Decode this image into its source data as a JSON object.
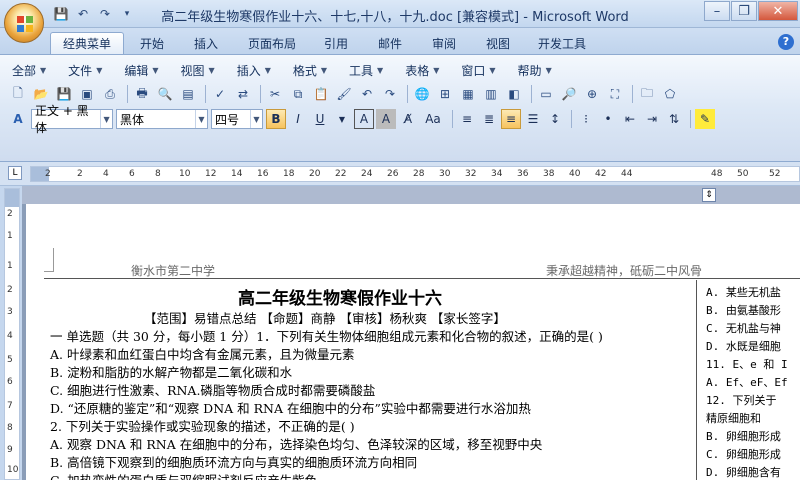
{
  "window": {
    "title": "高二年级生物寒假作业十六、十七,十八，十九.doc [兼容模式] - Microsoft Word"
  },
  "tabs": [
    "经典菜单",
    "开始",
    "插入",
    "页面布局",
    "引用",
    "邮件",
    "审阅",
    "视图",
    "开发工具"
  ],
  "active_tab": "经典菜单",
  "menu": [
    "全部",
    "文件",
    "编辑",
    "视图",
    "插入",
    "格式",
    "工具",
    "表格",
    "窗口",
    "帮助"
  ],
  "font": {
    "style": "正文 + 黑体",
    "family": "黑体",
    "size": "四号"
  },
  "ruler": {
    "h_numbers": [
      "2",
      "2",
      "4",
      "6",
      "8",
      "10",
      "12",
      "14",
      "16",
      "18",
      "20",
      "22",
      "24",
      "26",
      "28",
      "30",
      "32",
      "34",
      "36",
      "38",
      "40",
      "42",
      "44",
      "48",
      "50",
      "52"
    ],
    "v_numbers": [
      "2",
      "1",
      "1",
      "2",
      "3",
      "4",
      "5",
      "6",
      "7",
      "8",
      "9",
      "10"
    ]
  },
  "document": {
    "header_left": "衡水市第二中学",
    "header_right": "秉承超越精神，砥砺二中风骨",
    "title": "高二年级生物寒假作业十六",
    "lines": [
      "【范围】易错点总结  【命题】商静  【审核】杨秋爽  【家长签字】",
      "一 单选题（共 30 分，每小题 1 分）1．下列有关生物体细胞组成元素和化合物的叙述，正确的是(   )",
      "A. 叶绿素和血红蛋白中均含有金属元素，且为微量元素",
      "B. 淀粉和脂肪的水解产物都是二氧化碳和水",
      "C. 细胞进行性激素、RNA.磷脂等物质合成时都需要磷酸盐",
      "D. “还原糖的鉴定”和“观察 DNA 和 RNA 在细胞中的分布”实验中都需要进行水浴加热",
      "2. 下列关于实验操作或实验现象的描述，不正确的是(     )",
      "A. 观察 DNA 和 RNA 在细胞中的分布，选择染色均匀、色泽较深的区域，移至视野中央",
      "B. 高倍镜下观察到的细胞质环流方向与真实的细胞质环流方向相同",
      "C. 加热变性的蛋白质与双缩脲试剂反应产生紫色"
    ],
    "right_lines": [
      "A. 某些无机盐",
      "B. 由氨基酸形",
      "C. 无机盐与神",
      "D. 水既是细胞",
      "11. E、e 和 I",
      "A. Ef、eF、Ef",
      "12. 下列关于",
      "  精原细胞和",
      "B. 卵细胞形成",
      "C. 卵细胞形成",
      "D. 卵细胞含有"
    ]
  }
}
